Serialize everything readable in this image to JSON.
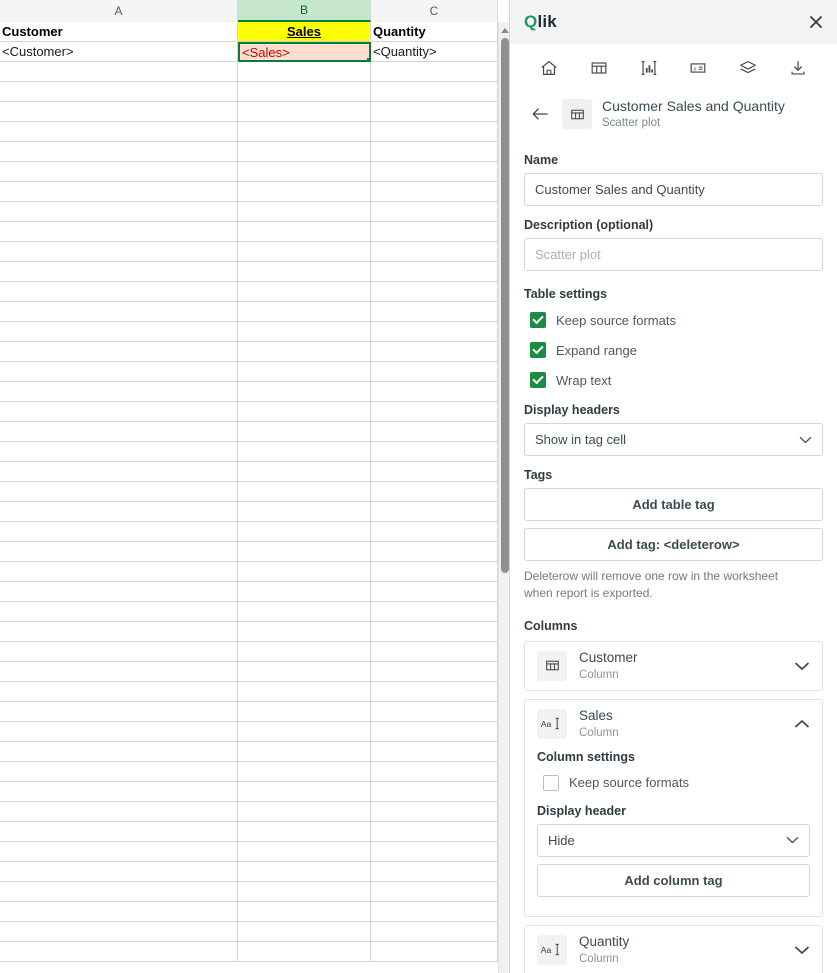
{
  "spreadsheet": {
    "column_headers": [
      "A",
      "B",
      "C"
    ],
    "selected_column": "B",
    "selected_cell": "B2",
    "rows": [
      {
        "a": "Customer",
        "b": "Sales",
        "c": "Quantity"
      },
      {
        "a": "<Customer>",
        "b": "<Sales>",
        "c": "<Quantity>"
      }
    ],
    "empty_row_count": 45,
    "scrollbar": {
      "name": "vertical-scrollbar"
    },
    "styles": {
      "header_b_background": "#ffff00",
      "selected_cell_background": "#fbe0d2",
      "selected_cell_text": "#d00000",
      "selection_border": "#0c7a3e",
      "selected_column_header_background": "#c6e7ce"
    }
  },
  "panel": {
    "app_title": "Qlik",
    "close_label": "✕",
    "toolbar": [
      {
        "name": "home-icon",
        "label": "Home"
      },
      {
        "name": "table-icon",
        "label": "Tables"
      },
      {
        "name": "chart-icon",
        "label": "Charts"
      },
      {
        "name": "formula-icon",
        "label": "Formula"
      },
      {
        "name": "layers-icon",
        "label": "Levels"
      },
      {
        "name": "download-icon",
        "label": "Download"
      }
    ],
    "breadcrumb": {
      "back_label": "←",
      "title": "Customer Sales and Quantity",
      "subtitle": "Scatter plot"
    },
    "name_field": {
      "label": "Name",
      "value": "Customer Sales and Quantity"
    },
    "description_field": {
      "label": "Description (optional)",
      "value": "",
      "placeholder": "Scatter plot"
    },
    "table_settings": {
      "title": "Table settings",
      "options": [
        {
          "label": "Keep source formats",
          "checked": true
        },
        {
          "label": "Expand range",
          "checked": true
        },
        {
          "label": "Wrap text",
          "checked": true
        }
      ]
    },
    "display_headers": {
      "label": "Display headers",
      "value": "Show in tag cell"
    },
    "tags": {
      "label": "Tags",
      "add_table_tag": "Add table tag",
      "add_deleterow_tag": "Add tag: <deleterow>",
      "help": "Deleterow will remove one row in the worksheet when report is exported."
    },
    "columns": {
      "label": "Columns",
      "items": [
        {
          "name": "Customer",
          "subtitle": "Column",
          "icon": "table-icon",
          "expanded": false
        },
        {
          "name": "Sales",
          "subtitle": "Column",
          "icon": "text-field-icon",
          "expanded": true,
          "settings_title": "Column settings",
          "keep_source_formats": {
            "label": "Keep source formats",
            "checked": false
          },
          "display_header": {
            "label": "Display header",
            "value": "Hide"
          },
          "add_column_tag": "Add column tag"
        },
        {
          "name": "Quantity",
          "subtitle": "Column",
          "icon": "text-field-icon",
          "expanded": false
        }
      ]
    }
  }
}
